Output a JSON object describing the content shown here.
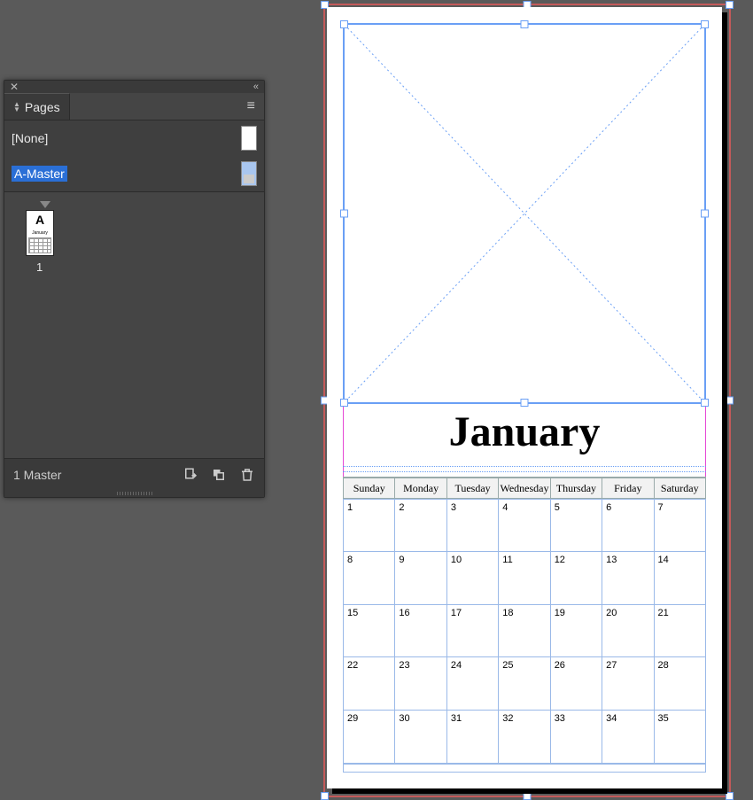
{
  "panel": {
    "title": "Pages",
    "masters": [
      {
        "label": "[None]",
        "selected": false
      },
      {
        "label": "A-Master",
        "selected": true
      }
    ],
    "page_letter": "A",
    "page_number": "1",
    "footer_status": "1 Master"
  },
  "document": {
    "month": "January",
    "weekdays": [
      "Sunday",
      "Monday",
      "Tuesday",
      "Wednesday",
      "Thursday",
      "Friday",
      "Saturday"
    ],
    "grid": [
      [
        "1",
        "2",
        "3",
        "4",
        "5",
        "6",
        "7"
      ],
      [
        "8",
        "9",
        "10",
        "11",
        "12",
        "13",
        "14"
      ],
      [
        "15",
        "16",
        "17",
        "18",
        "19",
        "20",
        "21"
      ],
      [
        "22",
        "23",
        "24",
        "25",
        "26",
        "27",
        "28"
      ],
      [
        "29",
        "30",
        "31",
        "32",
        "33",
        "34",
        "35"
      ]
    ]
  }
}
